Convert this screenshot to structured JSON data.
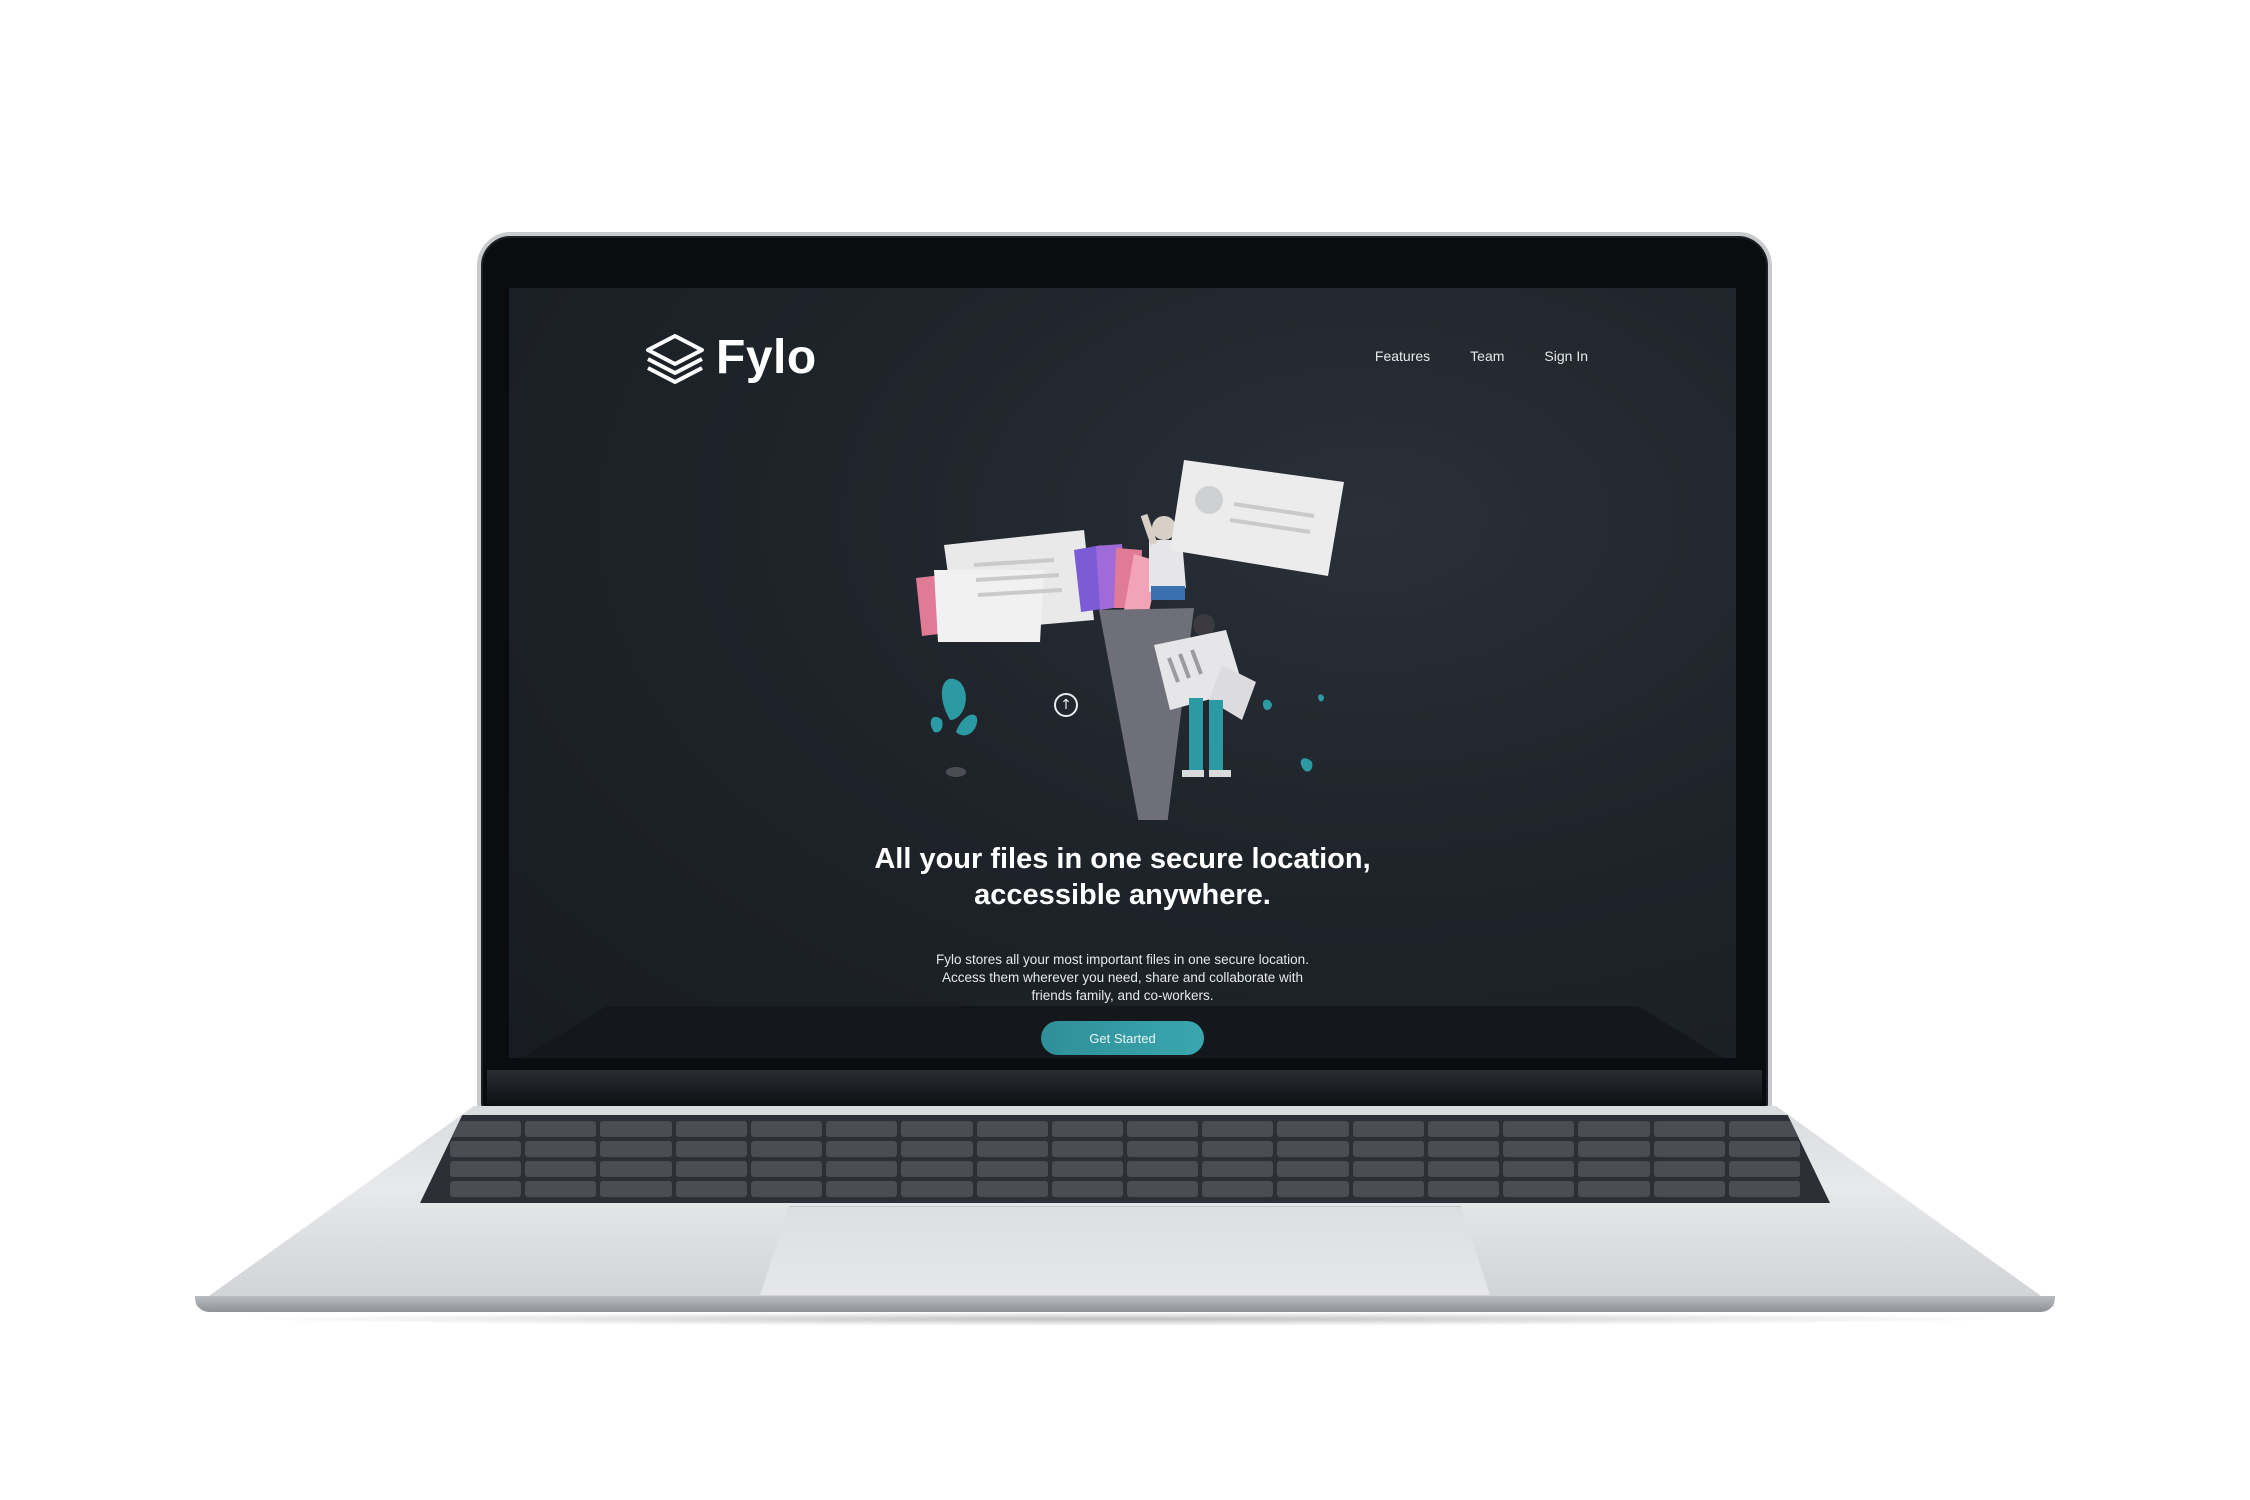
{
  "brand": {
    "name": "Fylo",
    "logo_icon": "stacked-layers-icon"
  },
  "nav": {
    "items": [
      "Features",
      "Team",
      "Sign In"
    ]
  },
  "hero": {
    "headline_line1": "All your files in one secure location,",
    "headline_line2": "accessible anywhere.",
    "sub_line1": "Fylo stores all your most important files in one secure location.",
    "sub_line2": "Access them wherever you need, share and collaborate with",
    "sub_line3": "friends family, and co-workers.",
    "cta_label": "Get Started",
    "upload_icon": "arrow-up-circle-icon"
  },
  "colors": {
    "background": "#1f242b",
    "accent": "#3aa6af",
    "text": "#ffffff"
  }
}
